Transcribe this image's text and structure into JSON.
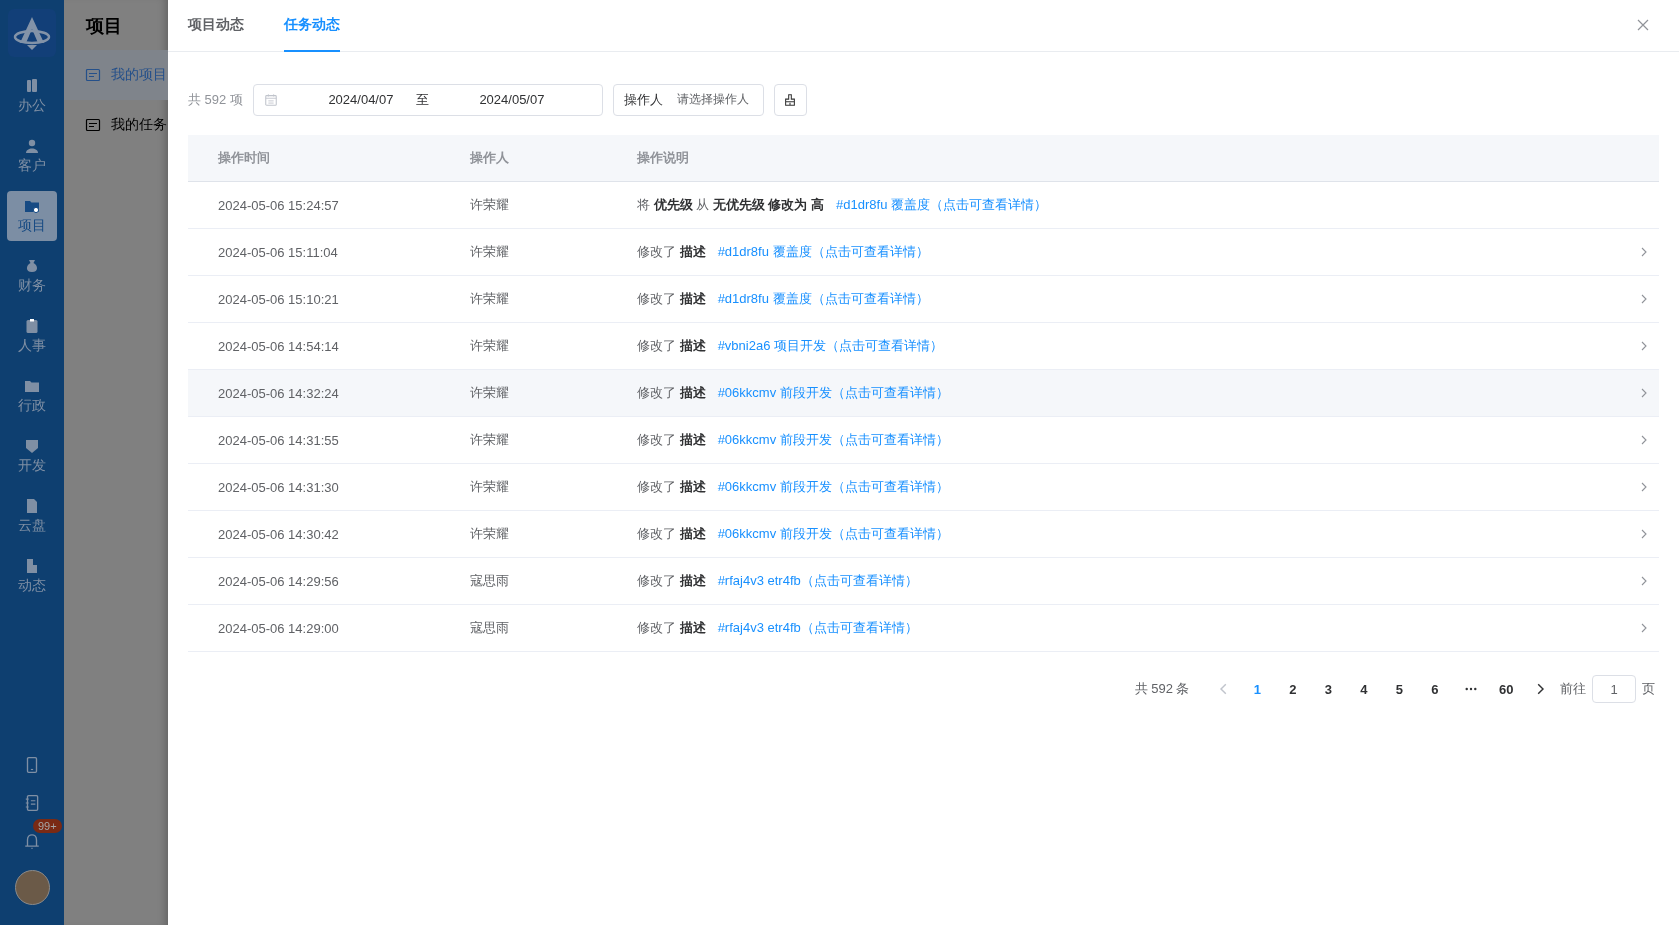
{
  "sidebar": {
    "items": [
      {
        "label": "办公",
        "selected": false
      },
      {
        "label": "客户",
        "selected": false
      },
      {
        "label": "项目",
        "selected": true
      },
      {
        "label": "财务",
        "selected": false
      },
      {
        "label": "人事",
        "selected": false
      },
      {
        "label": "行政",
        "selected": false
      },
      {
        "label": "开发",
        "selected": false
      },
      {
        "label": "云盘",
        "selected": false
      },
      {
        "label": "动态",
        "selected": false
      }
    ],
    "notification_badge": "99+"
  },
  "subnav": {
    "title": "项目",
    "items": [
      {
        "label": "我的项目",
        "selected": true
      },
      {
        "label": "我的任务",
        "selected": false
      }
    ]
  },
  "drawer": {
    "tabs": [
      {
        "label": "项目动态",
        "selected": false
      },
      {
        "label": "任务动态",
        "selected": true
      }
    ],
    "filter": {
      "total": "共 592 项",
      "date_start": "2024/04/07",
      "separator": "至",
      "date_end": "2024/05/07",
      "operator_label": "操作人",
      "operator_placeholder": "请选择操作人"
    },
    "table": {
      "columns": [
        "操作时间",
        "操作人",
        "操作说明"
      ],
      "rows": [
        {
          "time": "2024-05-06 15:24:57",
          "operator": "许荣耀",
          "description": "将 **优先级** 从 **无优先级** **修改为** **高**",
          "link": "#d1dr8fu 覆盖度（点击可查看详情）",
          "highlighted": false,
          "expandable": false
        },
        {
          "time": "2024-05-06 15:11:04",
          "operator": "许荣耀",
          "description": "修改了 **描述**",
          "link": "#d1dr8fu 覆盖度（点击可查看详情）",
          "highlighted": false,
          "expandable": true
        },
        {
          "time": "2024-05-06 15:10:21",
          "operator": "许荣耀",
          "description": "修改了 **描述**",
          "link": "#d1dr8fu 覆盖度（点击可查看详情）",
          "highlighted": false,
          "expandable": true
        },
        {
          "time": "2024-05-06 14:54:14",
          "operator": "许荣耀",
          "description": "修改了 **描述**",
          "link": "#vbni2a6 项目开发（点击可查看详情）",
          "highlighted": false,
          "expandable": true
        },
        {
          "time": "2024-05-06 14:32:24",
          "operator": "许荣耀",
          "description": "修改了 **描述**",
          "link": "#06kkcmv 前段开发（点击可查看详情）",
          "highlighted": true,
          "expandable": true
        },
        {
          "time": "2024-05-06 14:31:55",
          "operator": "许荣耀",
          "description": "修改了 **描述**",
          "link": "#06kkcmv 前段开发（点击可查看详情）",
          "highlighted": false,
          "expandable": true
        },
        {
          "time": "2024-05-06 14:31:30",
          "operator": "许荣耀",
          "description": "修改了 **描述**",
          "link": "#06kkcmv 前段开发（点击可查看详情）",
          "highlighted": false,
          "expandable": true
        },
        {
          "time": "2024-05-06 14:30:42",
          "operator": "许荣耀",
          "description": "修改了 **描述**",
          "link": "#06kkcmv 前段开发（点击可查看详情）",
          "highlighted": false,
          "expandable": true
        },
        {
          "time": "2024-05-06 14:29:56",
          "operator": "寇思雨",
          "description": "修改了 **描述**",
          "link": "#rfaj4v3 etr4fb（点击可查看详情）",
          "highlighted": false,
          "expandable": true
        },
        {
          "time": "2024-05-06 14:29:00",
          "operator": "寇思雨",
          "description": "修改了 **描述**",
          "link": "#rfaj4v3 etr4fb（点击可查看详情）",
          "highlighted": false,
          "expandable": true
        }
      ]
    },
    "pagination": {
      "total": "共 592 条",
      "prev_disabled": true,
      "next_disabled": false,
      "pages": [
        {
          "kind": "page",
          "label": "1",
          "selected": true
        },
        {
          "kind": "page",
          "label": "2",
          "selected": false
        },
        {
          "kind": "page",
          "label": "3",
          "selected": false
        },
        {
          "kind": "page",
          "label": "4",
          "selected": false
        },
        {
          "kind": "page",
          "label": "5",
          "selected": false
        },
        {
          "kind": "page",
          "label": "6",
          "selected": false
        },
        {
          "kind": "more"
        },
        {
          "kind": "page",
          "label": "60",
          "selected": false
        }
      ],
      "goto_label": "前往",
      "goto_value": "1",
      "goto_suffix": "页"
    }
  }
}
